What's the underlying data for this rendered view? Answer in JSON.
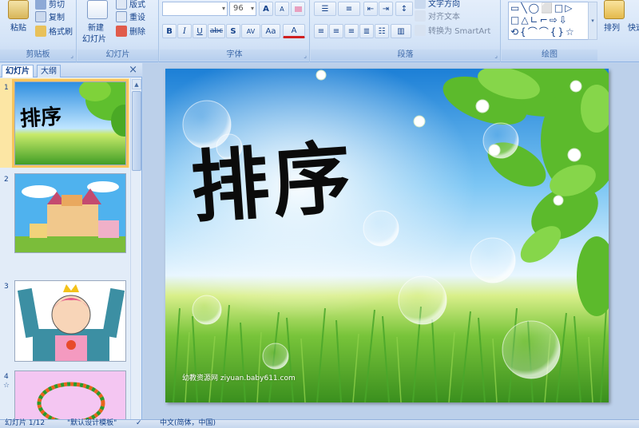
{
  "ribbon": {
    "clipboard": {
      "paste": "粘贴",
      "cut": "剪切",
      "copy": "复制",
      "format_painter": "格式刷",
      "group": "剪贴板"
    },
    "slides": {
      "new_slide": "新建",
      "new_slide_2": "幻灯片",
      "layout": "版式",
      "reset": "重设",
      "delete": "删除",
      "group": "幻灯片"
    },
    "font": {
      "size": "96",
      "bold": "B",
      "italic": "I",
      "underline": "U",
      "strike": "abc",
      "shadow": "S",
      "spacing": "AV",
      "case": "Aa",
      "color": "A",
      "grow": "A",
      "shrink": "A",
      "group": "字体"
    },
    "paragraph": {
      "text_direction": "文字方向",
      "align_text": "对齐文本",
      "smartart": "转换为 SmartArt",
      "group": "段落"
    },
    "drawing": {
      "arrange": "排列",
      "quick": "快速",
      "group": "绘图",
      "shapes_glyphs": "▭\\◯╲⬜□▷\n□△∟⌐⇨⇩▾\n⟲{ ⌒ ⌒ { } ☆"
    }
  },
  "pane": {
    "tab_slides": "幻灯片",
    "tab_outline": "大纲",
    "close": "×"
  },
  "thumbnails": [
    {
      "num": "1",
      "title": "排序"
    },
    {
      "num": "2"
    },
    {
      "num": "3"
    },
    {
      "num": "4"
    }
  ],
  "slide": {
    "title": "排序",
    "watermark": "幼教资源网 ziyuan.baby611.com"
  },
  "status": {
    "slide_count": "幻灯片 1/12",
    "theme": "\"默认设计模板\"",
    "language": "中文(简体，中国)"
  },
  "colors": {
    "ribbon": "#d3e3f7",
    "accent": "#15428b",
    "selection": "#f8c45c"
  }
}
